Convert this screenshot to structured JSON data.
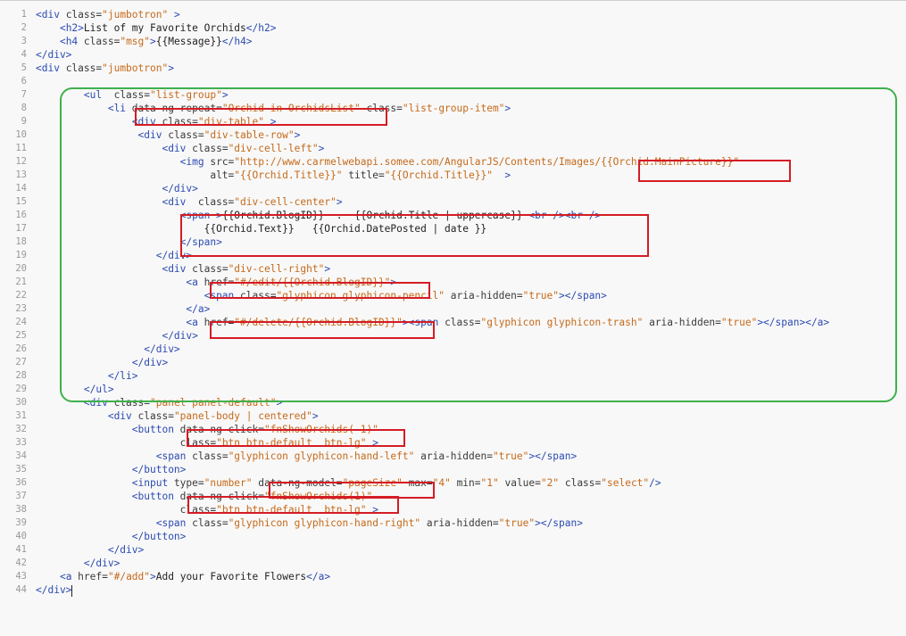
{
  "editor": {
    "line_numbers": [
      "1",
      "2",
      "3",
      "4",
      "5",
      "6",
      "7",
      "8",
      "9",
      "10",
      "11",
      "12",
      "13",
      "14",
      "15",
      "16",
      "17",
      "18",
      "19",
      "20",
      "21",
      "22",
      "23",
      "24",
      "25",
      "26",
      "27",
      "28",
      "29",
      "30",
      "31",
      "32",
      "33",
      "34",
      "35",
      "36",
      "37",
      "38",
      "39",
      "40",
      "41",
      "42",
      "43",
      "44"
    ],
    "lines": [
      {
        "indent": 0,
        "tokens": [
          {
            "k": "tag",
            "t": "<div "
          },
          {
            "k": "attr",
            "t": "class="
          },
          {
            "k": "str",
            "t": "\"jumbotron\""
          },
          {
            "k": "tag",
            "t": " >"
          }
        ]
      },
      {
        "indent": 4,
        "tokens": [
          {
            "k": "tag",
            "t": "<h2>"
          },
          {
            "k": "txt",
            "t": "List of my Favorite Orchids"
          },
          {
            "k": "tag",
            "t": "</h2>"
          }
        ]
      },
      {
        "indent": 4,
        "tokens": [
          {
            "k": "tag",
            "t": "<h4 "
          },
          {
            "k": "attr",
            "t": "class="
          },
          {
            "k": "str",
            "t": "\"msg\""
          },
          {
            "k": "tag",
            "t": ">"
          },
          {
            "k": "txt",
            "t": "{{Message}}"
          },
          {
            "k": "tag",
            "t": "</h4>"
          }
        ]
      },
      {
        "indent": 0,
        "tokens": [
          {
            "k": "tag",
            "t": "</div>"
          }
        ]
      },
      {
        "indent": 0,
        "tokens": [
          {
            "k": "tag",
            "t": "<div "
          },
          {
            "k": "attr",
            "t": "class="
          },
          {
            "k": "str",
            "t": "\"jumbotron\""
          },
          {
            "k": "tag",
            "t": ">"
          }
        ]
      },
      {
        "indent": 0,
        "tokens": []
      },
      {
        "indent": 8,
        "tokens": [
          {
            "k": "tag",
            "t": "<ul  "
          },
          {
            "k": "attr",
            "t": "class="
          },
          {
            "k": "str",
            "t": "\"list-group\""
          },
          {
            "k": "tag",
            "t": ">"
          }
        ]
      },
      {
        "indent": 12,
        "tokens": [
          {
            "k": "tag",
            "t": "<li "
          },
          {
            "k": "attr",
            "t": "data-ng-repeat="
          },
          {
            "k": "str",
            "t": "\"Orchid in OrchidsList\""
          },
          {
            "k": "attr",
            "t": " class="
          },
          {
            "k": "str",
            "t": "\"list-group-item\""
          },
          {
            "k": "tag",
            "t": ">"
          }
        ]
      },
      {
        "indent": 16,
        "tokens": [
          {
            "k": "tag",
            "t": "<div "
          },
          {
            "k": "attr",
            "t": "class="
          },
          {
            "k": "str",
            "t": "\"div-table\""
          },
          {
            "k": "tag",
            "t": " >"
          }
        ]
      },
      {
        "indent": 17,
        "tokens": [
          {
            "k": "tag",
            "t": "<div "
          },
          {
            "k": "attr",
            "t": "class="
          },
          {
            "k": "str",
            "t": "\"div-table-row\""
          },
          {
            "k": "tag",
            "t": ">"
          }
        ]
      },
      {
        "indent": 21,
        "tokens": [
          {
            "k": "tag",
            "t": "<div "
          },
          {
            "k": "attr",
            "t": "class="
          },
          {
            "k": "str",
            "t": "\"div-cell-left\""
          },
          {
            "k": "tag",
            "t": ">"
          }
        ]
      },
      {
        "indent": 24,
        "tokens": [
          {
            "k": "tag",
            "t": "<img "
          },
          {
            "k": "attr",
            "t": "src="
          },
          {
            "k": "str",
            "t": "\"http://www.carmelwebapi.somee.com/AngularJS/Contents/Images/{{Orchid.MainPicture}}\""
          }
        ]
      },
      {
        "indent": 29,
        "tokens": [
          {
            "k": "attr",
            "t": "alt="
          },
          {
            "k": "str",
            "t": "\"{{Orchid.Title}}\""
          },
          {
            "k": "attr",
            "t": " title="
          },
          {
            "k": "str",
            "t": "\"{{Orchid.Title}}\""
          },
          {
            "k": "tag",
            "t": "  >"
          }
        ]
      },
      {
        "indent": 21,
        "tokens": [
          {
            "k": "tag",
            "t": "</div>"
          }
        ]
      },
      {
        "indent": 21,
        "tokens": [
          {
            "k": "tag",
            "t": "<div  "
          },
          {
            "k": "attr",
            "t": "class="
          },
          {
            "k": "str",
            "t": "\"div-cell-center\""
          },
          {
            "k": "tag",
            "t": ">"
          }
        ]
      },
      {
        "indent": 24,
        "tokens": [
          {
            "k": "tag",
            "t": "<span >"
          },
          {
            "k": "txt",
            "t": "{{Orchid.BlogID}}  .  {{Orchid.Title | uppercase}} "
          },
          {
            "k": "tag",
            "t": "<br />"
          },
          {
            "k": "tag",
            "t": "<br />"
          }
        ]
      },
      {
        "indent": 28,
        "tokens": [
          {
            "k": "txt",
            "t": "{{Orchid.Text}}   {{Orchid.DatePosted | date }}"
          }
        ]
      },
      {
        "indent": 24,
        "tokens": [
          {
            "k": "tag",
            "t": "</span>"
          }
        ]
      },
      {
        "indent": 20,
        "tokens": [
          {
            "k": "tag",
            "t": "</div>"
          }
        ]
      },
      {
        "indent": 21,
        "tokens": [
          {
            "k": "tag",
            "t": "<div "
          },
          {
            "k": "attr",
            "t": "class="
          },
          {
            "k": "str",
            "t": "\"div-cell-right\""
          },
          {
            "k": "tag",
            "t": ">"
          }
        ]
      },
      {
        "indent": 25,
        "tokens": [
          {
            "k": "tag",
            "t": "<a "
          },
          {
            "k": "attr",
            "t": "href="
          },
          {
            "k": "str",
            "t": "\"#/edit/{{Orchid.BlogID}}\""
          },
          {
            "k": "tag",
            "t": ">"
          }
        ]
      },
      {
        "indent": 28,
        "tokens": [
          {
            "k": "tag",
            "t": "<span "
          },
          {
            "k": "attr",
            "t": "class="
          },
          {
            "k": "str",
            "t": "\"glyphicon glyphicon-pencil\""
          },
          {
            "k": "attr",
            "t": " aria-hidden="
          },
          {
            "k": "str",
            "t": "\"true\""
          },
          {
            "k": "tag",
            "t": "></span>"
          }
        ]
      },
      {
        "indent": 25,
        "tokens": [
          {
            "k": "tag",
            "t": "</a>"
          }
        ]
      },
      {
        "indent": 25,
        "tokens": [
          {
            "k": "tag",
            "t": "<a "
          },
          {
            "k": "attr",
            "t": "href="
          },
          {
            "k": "str",
            "t": "\"#/delete/{{Orchid.BlogID}}\""
          },
          {
            "k": "tag",
            "t": ">"
          },
          {
            "k": "tag",
            "t": "<span "
          },
          {
            "k": "attr",
            "t": "class="
          },
          {
            "k": "str",
            "t": "\"glyphicon glyphicon-trash\""
          },
          {
            "k": "attr",
            "t": " aria-hidden="
          },
          {
            "k": "str",
            "t": "\"true\""
          },
          {
            "k": "tag",
            "t": "></span></a>"
          }
        ]
      },
      {
        "indent": 21,
        "tokens": [
          {
            "k": "tag",
            "t": "</div>"
          }
        ]
      },
      {
        "indent": 18,
        "tokens": [
          {
            "k": "tag",
            "t": "</div>"
          }
        ]
      },
      {
        "indent": 16,
        "tokens": [
          {
            "k": "tag",
            "t": "</div>"
          }
        ]
      },
      {
        "indent": 12,
        "tokens": [
          {
            "k": "tag",
            "t": "</li>"
          }
        ]
      },
      {
        "indent": 8,
        "tokens": [
          {
            "k": "tag",
            "t": "</ul>"
          }
        ]
      },
      {
        "indent": 8,
        "tokens": [
          {
            "k": "tag",
            "t": "<div "
          },
          {
            "k": "attr",
            "t": "class="
          },
          {
            "k": "str",
            "t": "\"panel panel-default\""
          },
          {
            "k": "tag",
            "t": ">"
          }
        ]
      },
      {
        "indent": 12,
        "tokens": [
          {
            "k": "tag",
            "t": "<div "
          },
          {
            "k": "attr",
            "t": "class="
          },
          {
            "k": "str",
            "t": "\"panel-body | centered\""
          },
          {
            "k": "tag",
            "t": ">"
          }
        ]
      },
      {
        "indent": 16,
        "tokens": [
          {
            "k": "tag",
            "t": "<button "
          },
          {
            "k": "attr",
            "t": "data-ng-click="
          },
          {
            "k": "str",
            "t": "\"fnShowOrchids(-1)\""
          }
        ]
      },
      {
        "indent": 24,
        "tokens": [
          {
            "k": "attr",
            "t": "class="
          },
          {
            "k": "str",
            "t": "\"btn btn-default  btn-lg\""
          },
          {
            "k": "tag",
            "t": " >"
          }
        ]
      },
      {
        "indent": 20,
        "tokens": [
          {
            "k": "tag",
            "t": "<span "
          },
          {
            "k": "attr",
            "t": "class="
          },
          {
            "k": "str",
            "t": "\"glyphicon glyphicon-hand-left\""
          },
          {
            "k": "attr",
            "t": " aria-hidden="
          },
          {
            "k": "str",
            "t": "\"true\""
          },
          {
            "k": "tag",
            "t": "></span>"
          }
        ]
      },
      {
        "indent": 16,
        "tokens": [
          {
            "k": "tag",
            "t": "</button>"
          }
        ]
      },
      {
        "indent": 16,
        "tokens": [
          {
            "k": "tag",
            "t": "<input "
          },
          {
            "k": "attr",
            "t": "type="
          },
          {
            "k": "str",
            "t": "\"number\""
          },
          {
            "k": "attr",
            "t": " data-ng-model="
          },
          {
            "k": "str",
            "t": "\"pageSize\""
          },
          {
            "k": "attr",
            "t": " max="
          },
          {
            "k": "str",
            "t": "\"4\""
          },
          {
            "k": "attr",
            "t": " min="
          },
          {
            "k": "str",
            "t": "\"1\""
          },
          {
            "k": "attr",
            "t": " value="
          },
          {
            "k": "str",
            "t": "\"2\""
          },
          {
            "k": "attr",
            "t": " class="
          },
          {
            "k": "str",
            "t": "\"select\""
          },
          {
            "k": "tag",
            "t": "/>"
          }
        ]
      },
      {
        "indent": 16,
        "tokens": [
          {
            "k": "tag",
            "t": "<button "
          },
          {
            "k": "attr",
            "t": "data-ng-click="
          },
          {
            "k": "str",
            "t": "\"fnShowOrchids(1)\""
          }
        ]
      },
      {
        "indent": 24,
        "tokens": [
          {
            "k": "attr",
            "t": "class="
          },
          {
            "k": "str",
            "t": "\"btn btn-default  btn-lg\""
          },
          {
            "k": "tag",
            "t": " >"
          }
        ]
      },
      {
        "indent": 20,
        "tokens": [
          {
            "k": "tag",
            "t": "<span "
          },
          {
            "k": "attr",
            "t": "class="
          },
          {
            "k": "str",
            "t": "\"glyphicon glyphicon-hand-right\""
          },
          {
            "k": "attr",
            "t": " aria-hidden="
          },
          {
            "k": "str",
            "t": "\"true\""
          },
          {
            "k": "tag",
            "t": "></span>"
          }
        ]
      },
      {
        "indent": 16,
        "tokens": [
          {
            "k": "tag",
            "t": "</button>"
          }
        ]
      },
      {
        "indent": 12,
        "tokens": [
          {
            "k": "tag",
            "t": "</div>"
          }
        ]
      },
      {
        "indent": 8,
        "tokens": [
          {
            "k": "tag",
            "t": "</div>"
          }
        ]
      },
      {
        "indent": 4,
        "tokens": [
          {
            "k": "tag",
            "t": "<a "
          },
          {
            "k": "attr",
            "t": "href="
          },
          {
            "k": "str",
            "t": "\"#/add\""
          },
          {
            "k": "tag",
            "t": ">"
          },
          {
            "k": "txt",
            "t": "Add your Favorite Flowers"
          },
          {
            "k": "tag",
            "t": "</a>"
          }
        ]
      },
      {
        "indent": 0,
        "tokens": [
          {
            "k": "tag",
            "t": "</div>"
          }
        ],
        "cursor": true
      }
    ]
  },
  "colors": {
    "highlight_green": "#3fb14c",
    "highlight_red": "#d41c24",
    "tag": "#2c4bb1",
    "string": "#c56a1a"
  }
}
